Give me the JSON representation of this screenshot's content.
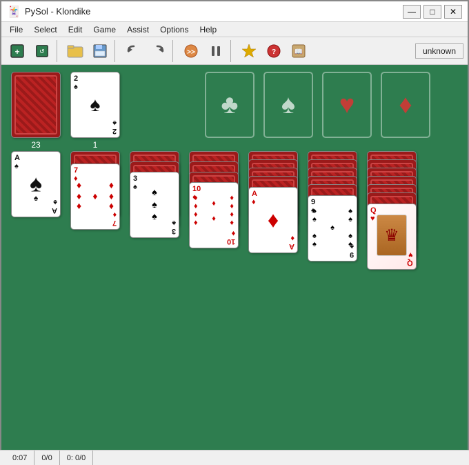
{
  "window": {
    "title": "PySol - Klondike",
    "icon": "🃏"
  },
  "title_controls": {
    "minimize": "—",
    "maximize": "□",
    "close": "✕"
  },
  "menu": {
    "items": [
      "File",
      "Select",
      "Edit",
      "Game",
      "Assist",
      "Options",
      "Help"
    ]
  },
  "toolbar": {
    "buttons": [
      {
        "name": "new-game",
        "icon": "🃏"
      },
      {
        "name": "restart",
        "icon": "↺"
      },
      {
        "name": "open",
        "icon": "📂"
      },
      {
        "name": "save",
        "icon": "💾"
      },
      {
        "name": "undo",
        "icon": "◁"
      },
      {
        "name": "redo",
        "icon": "▷"
      },
      {
        "name": "auto-play",
        "icon": "⏩"
      },
      {
        "name": "pause",
        "icon": "⏸"
      },
      {
        "name": "stats",
        "icon": "⭐"
      },
      {
        "name": "options2",
        "icon": "🎯"
      },
      {
        "name": "help2",
        "icon": "📖"
      }
    ],
    "badge": "unknown"
  },
  "status_bar": {
    "time": "0:07",
    "score": "0/0",
    "moves": "0: 0/0"
  },
  "game": {
    "stock_count": "23",
    "waste_count": "1",
    "foundation": {
      "clubs_symbol": "♣",
      "spades_symbol": "♠",
      "hearts_symbol": "♥",
      "diamonds_symbol": "♦"
    },
    "tableau": [
      {
        "col": 0,
        "cards": [
          {
            "rank": "A",
            "suit": "♠",
            "color": "black",
            "face": true
          }
        ]
      },
      {
        "col": 1,
        "cards": [
          {
            "rank": "7",
            "suit": "♦",
            "color": "red",
            "face": true
          }
        ]
      },
      {
        "col": 2,
        "cards": [
          {
            "rank": "3",
            "suit": "♠",
            "color": "black",
            "face": true
          }
        ]
      },
      {
        "col": 3,
        "cards": [
          {
            "rank": "10",
            "suit": "♦",
            "color": "red",
            "face": true
          }
        ]
      },
      {
        "col": 4,
        "cards": [
          {
            "rank": "A",
            "suit": "♦",
            "color": "red",
            "face": true
          }
        ]
      },
      {
        "col": 5,
        "cards": [
          {
            "rank": "9",
            "suit": "♠",
            "color": "black",
            "face": true
          }
        ]
      },
      {
        "col": 6,
        "cards": [
          {
            "rank": "Q",
            "suit": "♥",
            "color": "red",
            "face": true
          }
        ]
      }
    ]
  }
}
